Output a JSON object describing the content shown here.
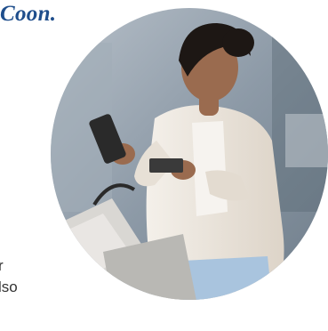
{
  "heading": {
    "fragment": "Coon."
  },
  "body_text": {
    "line1_fragment": "r",
    "line2_fragment": "lso"
  },
  "photo": {
    "subject": "woman-holding-phone-and-card-with-shopping-bags",
    "shape": "circle",
    "colors": {
      "jacket": "#ece6dd",
      "jeans": "#a9c4de",
      "bags": "#c9c9c7",
      "phone": "#2a2a2a",
      "skin": "#9a6b4f",
      "hair": "#1d1714",
      "background": "#8d9aa7"
    }
  }
}
